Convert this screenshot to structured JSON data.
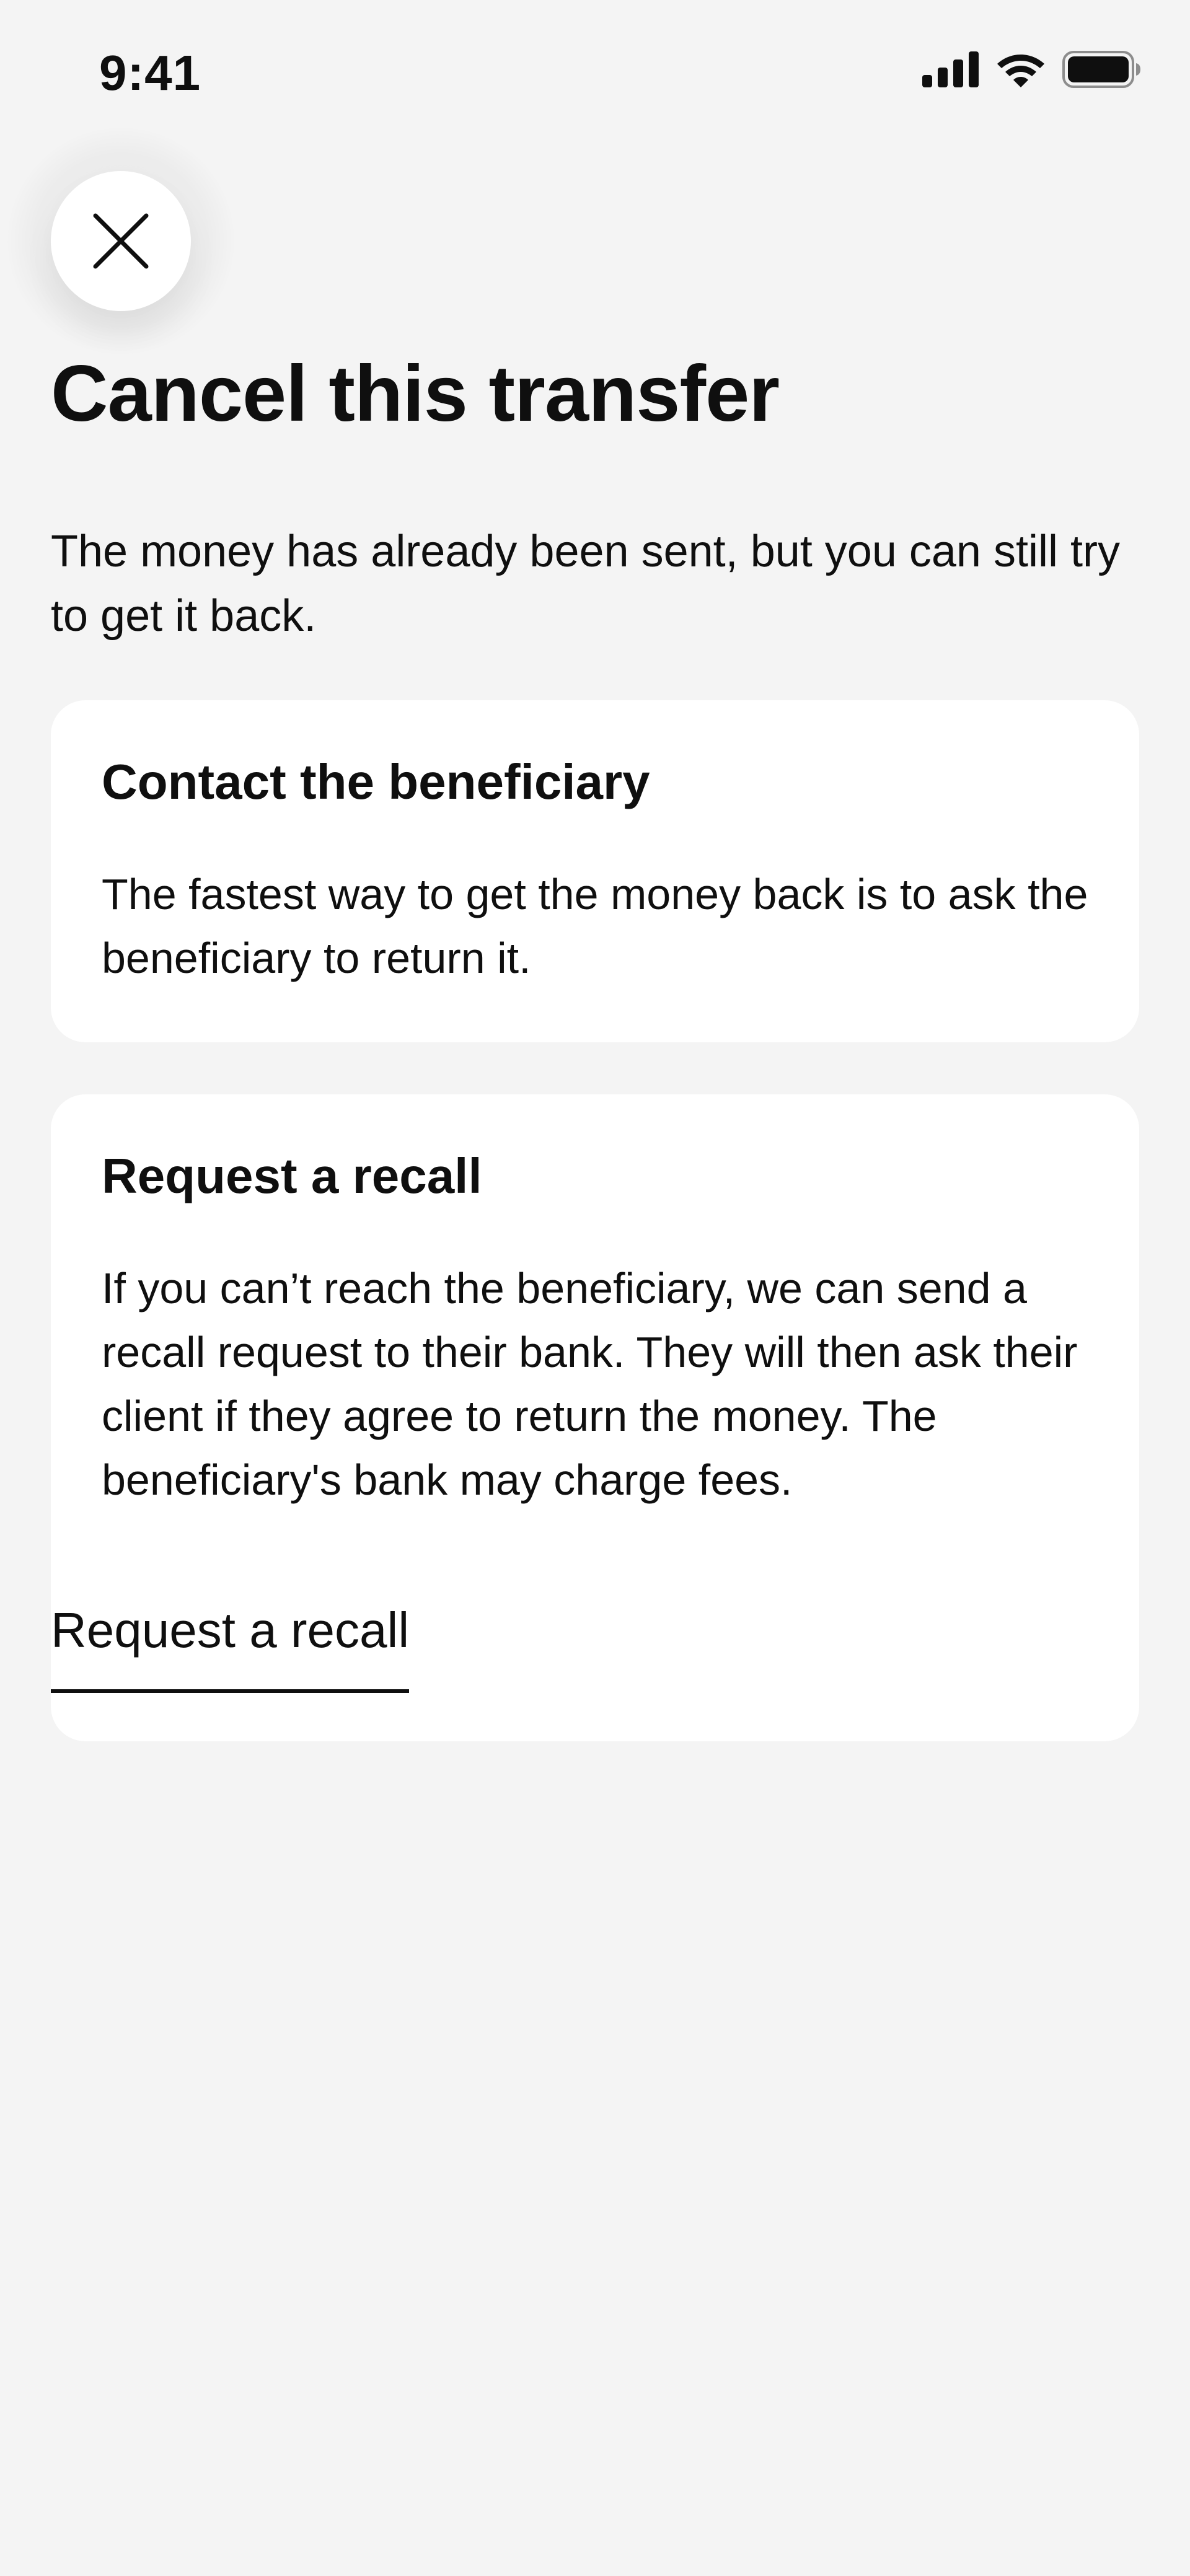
{
  "status_bar": {
    "time": "9:41",
    "icons": [
      "cellular-signal-icon",
      "wifi-icon",
      "battery-icon"
    ]
  },
  "header": {
    "close_icon": "close-icon",
    "title": "Cancel this transfer"
  },
  "intro": "The money has already been sent, but you can still try to get it back.",
  "cards": [
    {
      "title": "Contact the beneficiary",
      "text": "The fastest way to get the money back is to ask the beneficiary to return it."
    },
    {
      "title": "Request a recall",
      "text": "If you can’t reach the beneficiary, we can send a recall request to their bank. They will then ask their client if they agree to return the money. The beneficiary's bank may charge fees.",
      "link_label": "Request a recall"
    }
  ],
  "colors": {
    "background": "#f4f4f4",
    "card": "#ffffff",
    "text": "#0f0f0f"
  }
}
